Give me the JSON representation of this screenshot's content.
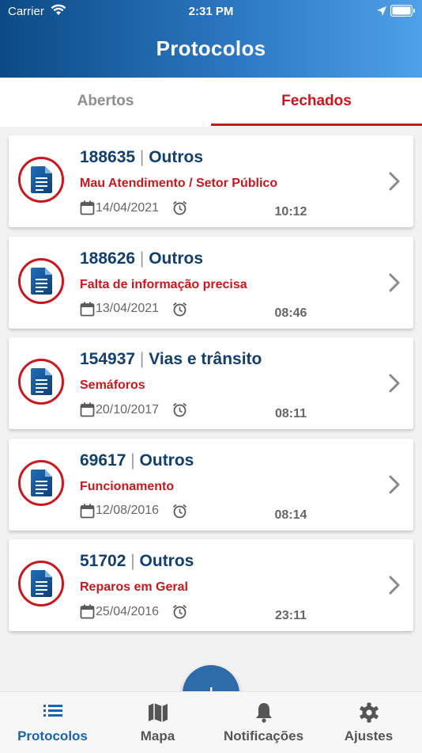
{
  "status_bar": {
    "carrier": "Carrier",
    "time": "2:31 PM"
  },
  "header": {
    "title": "Protocolos"
  },
  "tabs": [
    {
      "label": "Abertos",
      "active": false
    },
    {
      "label": "Fechados",
      "active": true
    }
  ],
  "protocols": [
    {
      "number": "188635",
      "category": "Outros",
      "subject": "Mau Atendimento / Setor Público",
      "date": "14/04/2021",
      "time": "10:12"
    },
    {
      "number": "188626",
      "category": "Outros",
      "subject": "Falta de informação precisa",
      "date": "13/04/2021",
      "time": "08:46"
    },
    {
      "number": "154937",
      "category": "Vias e trânsito",
      "subject": "Semáforos",
      "date": "20/10/2017",
      "time": "08:11"
    },
    {
      "number": "69617",
      "category": "Outros",
      "subject": "Funcionamento",
      "date": "12/08/2016",
      "time": "08:14"
    },
    {
      "number": "51702",
      "category": "Outros",
      "subject": "Reparos em Geral",
      "date": "25/04/2016",
      "time": "23:11"
    }
  ],
  "fab": {
    "icon": "plus-icon"
  },
  "bottom_nav": [
    {
      "label": "Protocolos",
      "icon": "list-icon",
      "active": true
    },
    {
      "label": "Mapa",
      "icon": "map-icon",
      "active": false
    },
    {
      "label": "Notificações",
      "icon": "bell-icon",
      "active": false
    },
    {
      "label": "Ajustes",
      "icon": "gear-icon",
      "active": false
    }
  ],
  "colors": {
    "header_start": "#0b4a86",
    "header_end": "#4ea1e8",
    "accent_red": "#c8171d",
    "title_blue": "#123f6d",
    "fab_blue": "#2d6ca8",
    "nav_active": "#1a63ae"
  }
}
